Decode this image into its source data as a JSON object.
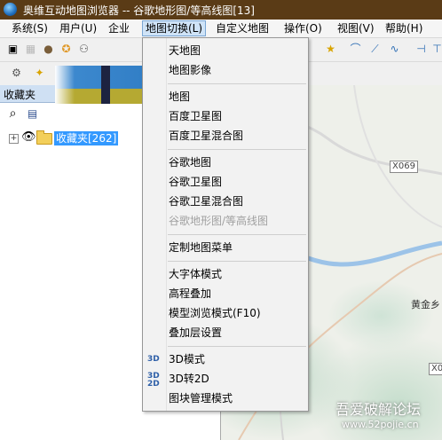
{
  "window": {
    "title": "奥维互动地图浏览器 -- 谷歌地形图/等高线图[13]"
  },
  "menubar": [
    "系统(S)",
    "用户(U)",
    "企业",
    "地图切换(L)",
    "自定义地图",
    "操作(O)",
    "视图(V)",
    "帮助(H)"
  ],
  "sidebar": {
    "header": "收藏夹",
    "tree_expander": "+",
    "tree_root_label": "收藏夹[262]"
  },
  "dropdown": {
    "group1": [
      "天地图",
      "地图影像"
    ],
    "group2": [
      "地图",
      "百度卫星图",
      "百度卫星混合图"
    ],
    "group3": [
      "谷歌地图",
      "谷歌卫星图",
      "谷歌卫星混合图",
      "谷歌地形图/等高线图"
    ],
    "group4": [
      "定制地图菜单"
    ],
    "group5": [
      "大字体模式",
      "高程叠加",
      "模型浏览模式(F10)",
      "叠加层设置"
    ],
    "group6": [
      "3D模式",
      "3D转2D",
      "图块管理模式"
    ],
    "icon_3d": "3D",
    "icon_3d2d_top": "3D",
    "icon_3d2d_bottom": "2D"
  },
  "map": {
    "road_label": "X069",
    "road_label2": "X0",
    "place_partial": "黄金乡"
  },
  "watermark": {
    "line1": "吾爱破解论坛",
    "line2": "www.52pojie.cn"
  }
}
